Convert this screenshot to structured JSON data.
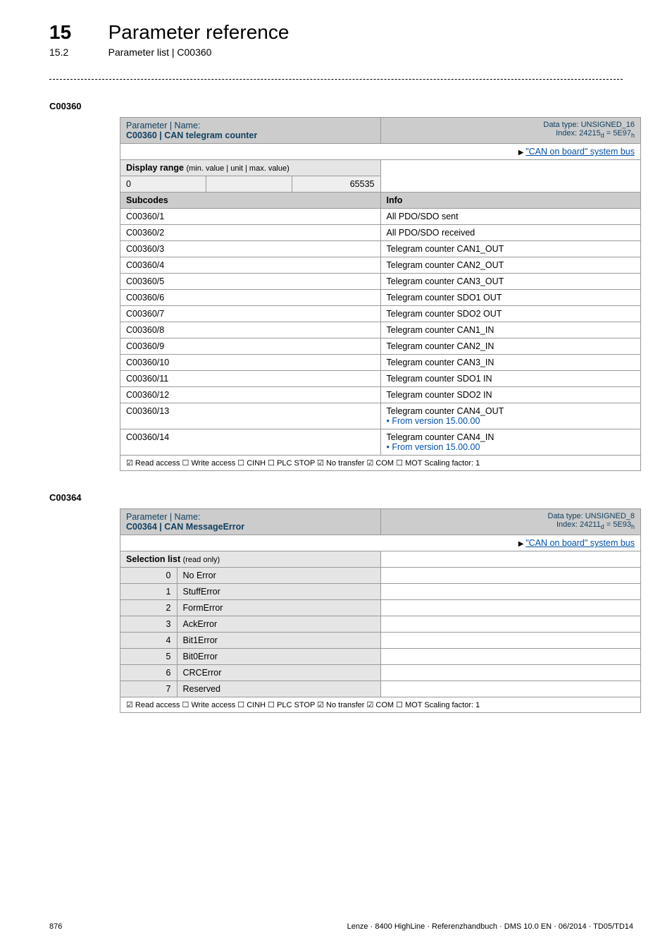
{
  "header": {
    "chapter_num": "15",
    "chapter_title": "Parameter reference",
    "section_num": "15.2",
    "section_title": "Parameter list | C00360"
  },
  "anchor1": "C00360",
  "table1": {
    "hdr_label": "Parameter | Name:",
    "hdr_name": "C00360 | CAN telegram counter",
    "hdr_type": "Data type: UNSIGNED_16",
    "hdr_index": "Index: 24215",
    "hdr_index_d": "d",
    "hdr_index_eq": " = 5E97",
    "hdr_index_h": "h",
    "link_text": "\"CAN on board\" system bus",
    "range_label": "Display range ",
    "range_small": "(min. value | unit | max. value)",
    "range_min": "0",
    "range_max": "65535",
    "subcodes_label": "Subcodes",
    "info_label": "Info",
    "rows": [
      {
        "sc": "C00360/1",
        "info": "All PDO/SDO sent"
      },
      {
        "sc": "C00360/2",
        "info": "All PDO/SDO received"
      },
      {
        "sc": "C00360/3",
        "info": "Telegram counter CAN1_OUT"
      },
      {
        "sc": "C00360/4",
        "info": "Telegram counter CAN2_OUT"
      },
      {
        "sc": "C00360/5",
        "info": "Telegram counter CAN3_OUT"
      },
      {
        "sc": "C00360/6",
        "info": "Telegram counter SDO1 OUT"
      },
      {
        "sc": "C00360/7",
        "info": "Telegram counter SDO2 OUT"
      },
      {
        "sc": "C00360/8",
        "info": "Telegram counter CAN1_IN"
      },
      {
        "sc": "C00360/9",
        "info": "Telegram counter CAN2_IN"
      },
      {
        "sc": "C00360/10",
        "info": "Telegram counter CAN3_IN"
      },
      {
        "sc": "C00360/11",
        "info": "Telegram counter SDO1 IN"
      },
      {
        "sc": "C00360/12",
        "info": "Telegram counter SDO2 IN"
      }
    ],
    "row13_sc": "C00360/13",
    "row13_info": "Telegram counter CAN4_OUT",
    "row13_link": "From version 15.00.00",
    "row14_sc": "C00360/14",
    "row14_info": "Telegram counter CAN4_IN",
    "row14_link": "From version 15.00.00",
    "access": "☑ Read access  ☐ Write access  ☐ CINH  ☐ PLC STOP  ☑ No transfer  ☑ COM  ☐ MOT   Scaling factor: 1"
  },
  "anchor2": "C00364",
  "table2": {
    "hdr_label": "Parameter | Name:",
    "hdr_name": "C00364 | CAN MessageError",
    "hdr_type": "Data type: UNSIGNED_8",
    "hdr_index": "Index: 24211",
    "hdr_index_d": "d",
    "hdr_index_eq": " = 5E93",
    "hdr_index_h": "h",
    "link_text": "\"CAN on board\" system bus",
    "sel_label": "Selection list ",
    "sel_small": "(read only)",
    "rows": [
      {
        "n": "0",
        "v": "No Error"
      },
      {
        "n": "1",
        "v": "StuffError"
      },
      {
        "n": "2",
        "v": "FormError"
      },
      {
        "n": "3",
        "v": "AckError"
      },
      {
        "n": "4",
        "v": "Bit1Error"
      },
      {
        "n": "5",
        "v": "Bit0Error"
      },
      {
        "n": "6",
        "v": "CRCError"
      },
      {
        "n": "7",
        "v": "Reserved"
      }
    ],
    "access": "☑ Read access  ☐ Write access  ☐ CINH  ☐ PLC STOP  ☑ No transfer  ☑ COM  ☐ MOT    Scaling factor: 1"
  },
  "footer": {
    "page": "876",
    "info": "Lenze · 8400 HighLine · Referenzhandbuch · DMS 10.0 EN · 06/2014 · TD05/TD14"
  }
}
